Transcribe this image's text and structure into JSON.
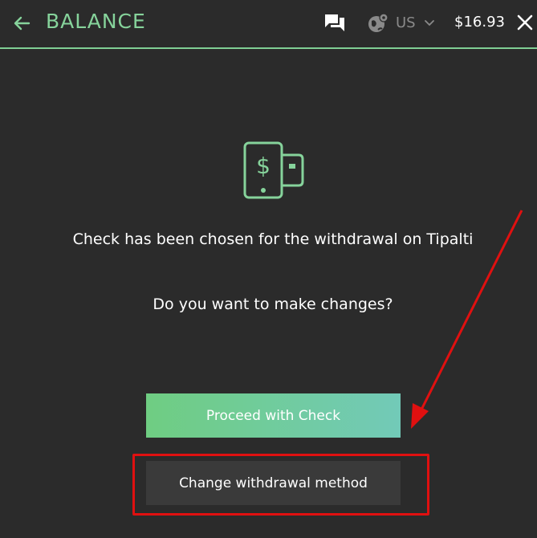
{
  "header": {
    "title": "BALANCE",
    "region": "US",
    "balance": "$16.93",
    "icons": [
      "arrow-left-icon",
      "chat-icon",
      "globe-icon",
      "chevron-down-icon",
      "close-icon"
    ]
  },
  "content": {
    "icon": "wallet-dollar-icon",
    "message": "Check has been chosen for the withdrawal on Tipalti",
    "question": "Do you want to make changes?"
  },
  "actions": {
    "proceed_label": "Proceed with Check",
    "change_label": "Change withdrawal method"
  },
  "colors": {
    "background": "#2b2b2b",
    "accent": "#86d39b",
    "button_gradient_start": "#6fcd82",
    "button_gradient_end": "#72cab8",
    "secondary_button": "#3a3a3a",
    "annotation": "#e01010"
  }
}
